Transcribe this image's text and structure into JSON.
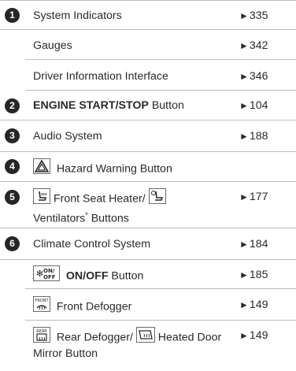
{
  "arrow": "►",
  "rows": [
    {
      "num": "1",
      "label": "System Indicators",
      "page": "335"
    },
    {
      "label": "Gauges",
      "page": "342"
    },
    {
      "label": "Driver Information Interface",
      "page": "346"
    },
    {
      "num": "2",
      "label_bold": "ENGINE START/STOP",
      "label_rest": " Button",
      "page": "104"
    },
    {
      "num": "3",
      "label": "Audio System",
      "page": "188"
    },
    {
      "num": "4",
      "label": "Hazard Warning Button",
      "icon": "hazard-warning-icon"
    },
    {
      "num": "5",
      "label_line1a": "Front Seat Heater/ ",
      "label_line2": "Ventilators",
      "asterisk": "*",
      "label_line2b": " Buttons",
      "page": "177",
      "icons": [
        "seat-heater-icon",
        "seat-ventilator-icon"
      ]
    },
    {
      "num": "6",
      "label": "Climate Control System",
      "page": "184"
    },
    {
      "label_bold": "ON/OFF",
      "label_rest": " Button",
      "page": "185",
      "icon": "climate-on-off-icon",
      "icon_text": "ON/ OFF"
    },
    {
      "label": "Front Defogger",
      "page": "149",
      "icon": "front-defogger-icon",
      "icon_text": "FRONT"
    },
    {
      "label_line1a": "Rear Defogger/ ",
      "label_line1b": "Heated Door",
      "label_line2": "Mirror Button",
      "page": "149",
      "icons": [
        "rear-defogger-icon",
        "heated-mirror-icon"
      ],
      "icon_text": "REAR"
    }
  ]
}
